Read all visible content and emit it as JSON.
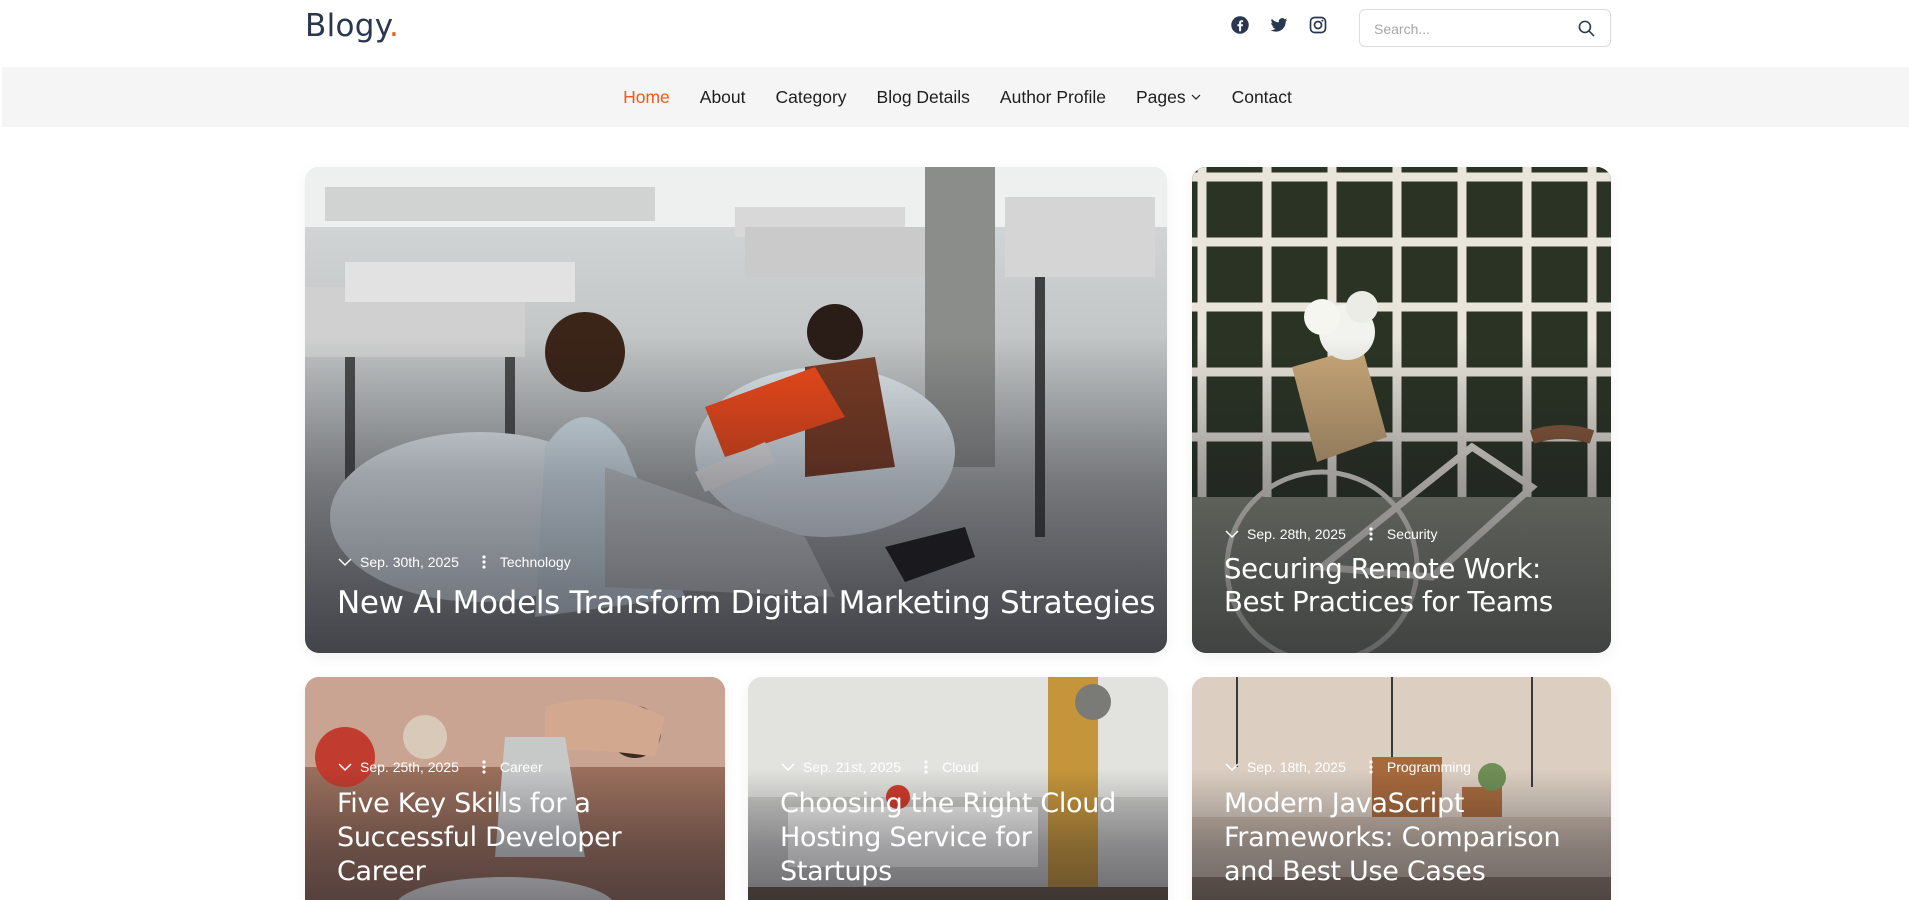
{
  "header": {
    "logo_text": "Blogy",
    "logo_dot": ".",
    "socials": [
      "facebook-icon",
      "twitter-icon",
      "instagram-icon"
    ],
    "search_placeholder": "Search..."
  },
  "nav": {
    "items": [
      {
        "label": "Home",
        "active": true
      },
      {
        "label": "About"
      },
      {
        "label": "Category"
      },
      {
        "label": "Blog Details"
      },
      {
        "label": "Author Profile"
      },
      {
        "label": "Pages",
        "has_dropdown": true
      },
      {
        "label": "Contact"
      }
    ]
  },
  "colors": {
    "accent": "#f05a1a",
    "logo": "#2a3750",
    "nav_bg": "#f5f5f5"
  },
  "posts": [
    {
      "date": "Sep. 30th, 2025",
      "category": "Technology",
      "title": "New AI Models Transform Digital Marketing Strategies"
    },
    {
      "date": "Sep. 28th, 2025",
      "category": "Security",
      "title": "Securing Remote Work: Best Practices for Teams"
    },
    {
      "date": "Sep. 25th, 2025",
      "category": "Career",
      "title": "Five Key Skills for a Successful Developer Career"
    },
    {
      "date": "Sep. 21st, 2025",
      "category": "Cloud",
      "title": "Choosing the Right Cloud Hosting Service for Startups"
    },
    {
      "date": "Sep. 18th, 2025",
      "category": "Programming",
      "title": "Modern JavaScript Frameworks: Comparison and Best Use Cases"
    }
  ]
}
